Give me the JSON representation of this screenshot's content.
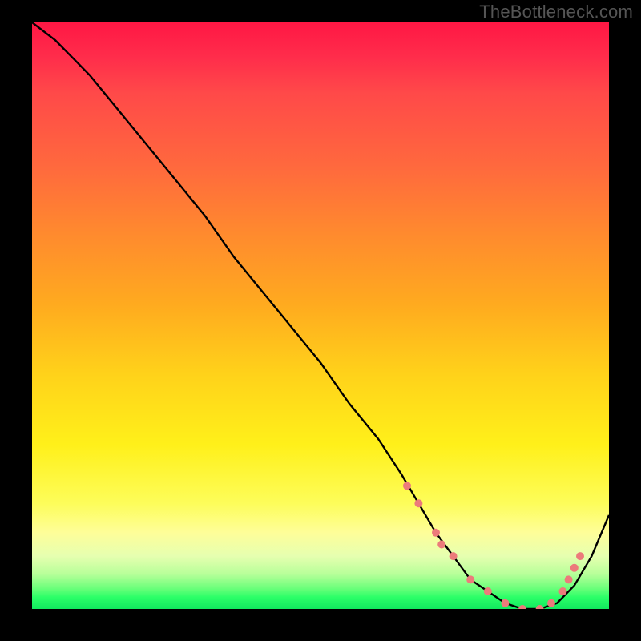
{
  "watermark": "TheBottleneck.com",
  "chart_data": {
    "type": "line",
    "title": "",
    "xlabel": "",
    "ylabel": "",
    "xlim": [
      0,
      100
    ],
    "ylim": [
      0,
      100
    ],
    "gradient_stops": [
      {
        "pos": 0,
        "color": "#ff1744"
      },
      {
        "pos": 25,
        "color": "#ff6a3d"
      },
      {
        "pos": 50,
        "color": "#ffaa1f"
      },
      {
        "pos": 72,
        "color": "#fff01a"
      },
      {
        "pos": 90,
        "color": "#fefe99"
      },
      {
        "pos": 98,
        "color": "#2bff68"
      },
      {
        "pos": 100,
        "color": "#11e95e"
      }
    ],
    "series": [
      {
        "name": "curve",
        "x": [
          0,
          4,
          8,
          10,
          15,
          20,
          25,
          30,
          35,
          40,
          45,
          50,
          55,
          60,
          64,
          67,
          70,
          73,
          76,
          79,
          82,
          85,
          88,
          91,
          94,
          97,
          100
        ],
        "y": [
          100,
          97,
          93,
          91,
          85,
          79,
          73,
          67,
          60,
          54,
          48,
          42,
          35,
          29,
          23,
          18,
          13,
          9,
          5,
          3,
          1,
          0,
          0,
          1,
          4,
          9,
          16
        ]
      }
    ],
    "markers": {
      "name": "dots",
      "x": [
        65,
        67,
        70,
        71,
        73,
        76,
        79,
        82,
        85,
        88,
        90,
        92,
        93,
        94,
        95
      ],
      "y": [
        21,
        18,
        13,
        11,
        9,
        5,
        3,
        1,
        0,
        0,
        1,
        3,
        5,
        7,
        9
      ]
    }
  }
}
